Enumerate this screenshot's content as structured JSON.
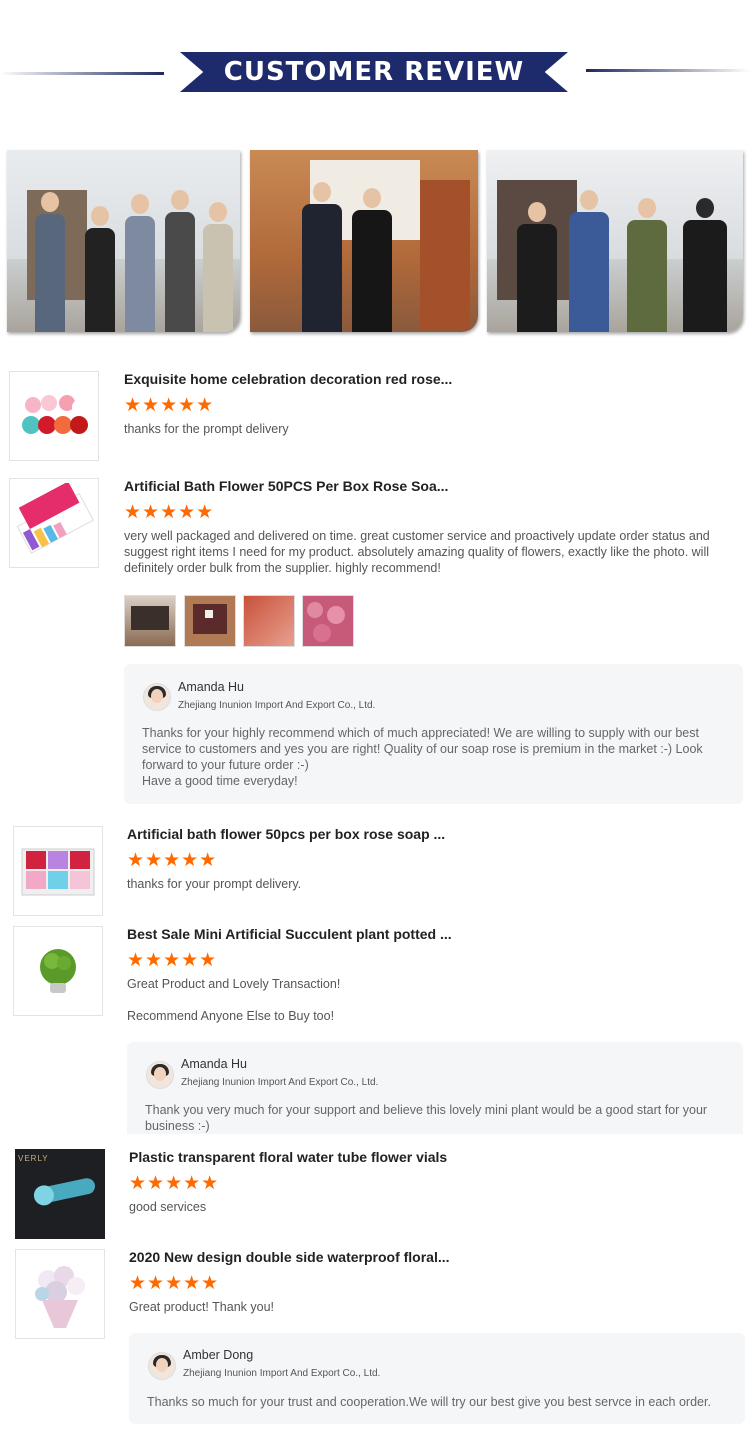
{
  "header": {
    "title": "CUSTOMER REVIEW"
  },
  "reviews": [
    {
      "title": "Exquisite home celebration decoration red rose...",
      "stars": "★★★★★",
      "text": "thanks for the prompt delivery"
    },
    {
      "title": "Artificial Bath Flower 50PCS Per Box Rose Soa...",
      "stars": "★★★★★",
      "text": "very well packaged and delivered on time. great customer service and proactively update order status and suggest right items I need for my product. absolutely amazing quality of flowers, exactly like the photo. will definitely order bulk from the supplier. highly recommend!",
      "reply": {
        "name": "Amanda Hu",
        "company": "Zhejiang Inunion Import And Export Co., Ltd.",
        "text": "Thanks for your highly recommend which of much appreciated! We are willing to supply with our best service to customers and yes you are right! Quality of  our soap rose is premium in the market :-) Look forward to your future order :-)",
        "text2": "Have a good time everyday!"
      }
    },
    {
      "title": "Artificial bath flower 50pcs per box rose soap ...",
      "stars": "★★★★★",
      "text": "thanks for your prompt delivery."
    },
    {
      "title": "Best Sale Mini Artificial Succulent plant potted ...",
      "stars": "★★★★★",
      "text": "Great Product and Lovely Transaction!",
      "text2": "Recommend Anyone Else to Buy too!",
      "reply": {
        "name": "Amanda Hu",
        "company": "Zhejiang Inunion Import And Export Co., Ltd.",
        "text": "Thank you very much for your support and believe this lovely mini plant would be a good start for your business :-)"
      }
    },
    {
      "title": "Plastic transparent floral water tube flower vials",
      "stars": "★★★★★",
      "text": "good services",
      "thumb_text": "VERLY"
    },
    {
      "title": "2020 New design double side waterproof floral...",
      "stars": "★★★★★",
      "text": "Great product! Thank you!",
      "reply": {
        "name": "Amber Dong",
        "company": "Zhejiang Inunion Import And Export Co., Ltd.",
        "text": "Thanks so much for your trust and cooperation.We will try our best give you best servce in each order."
      }
    }
  ]
}
